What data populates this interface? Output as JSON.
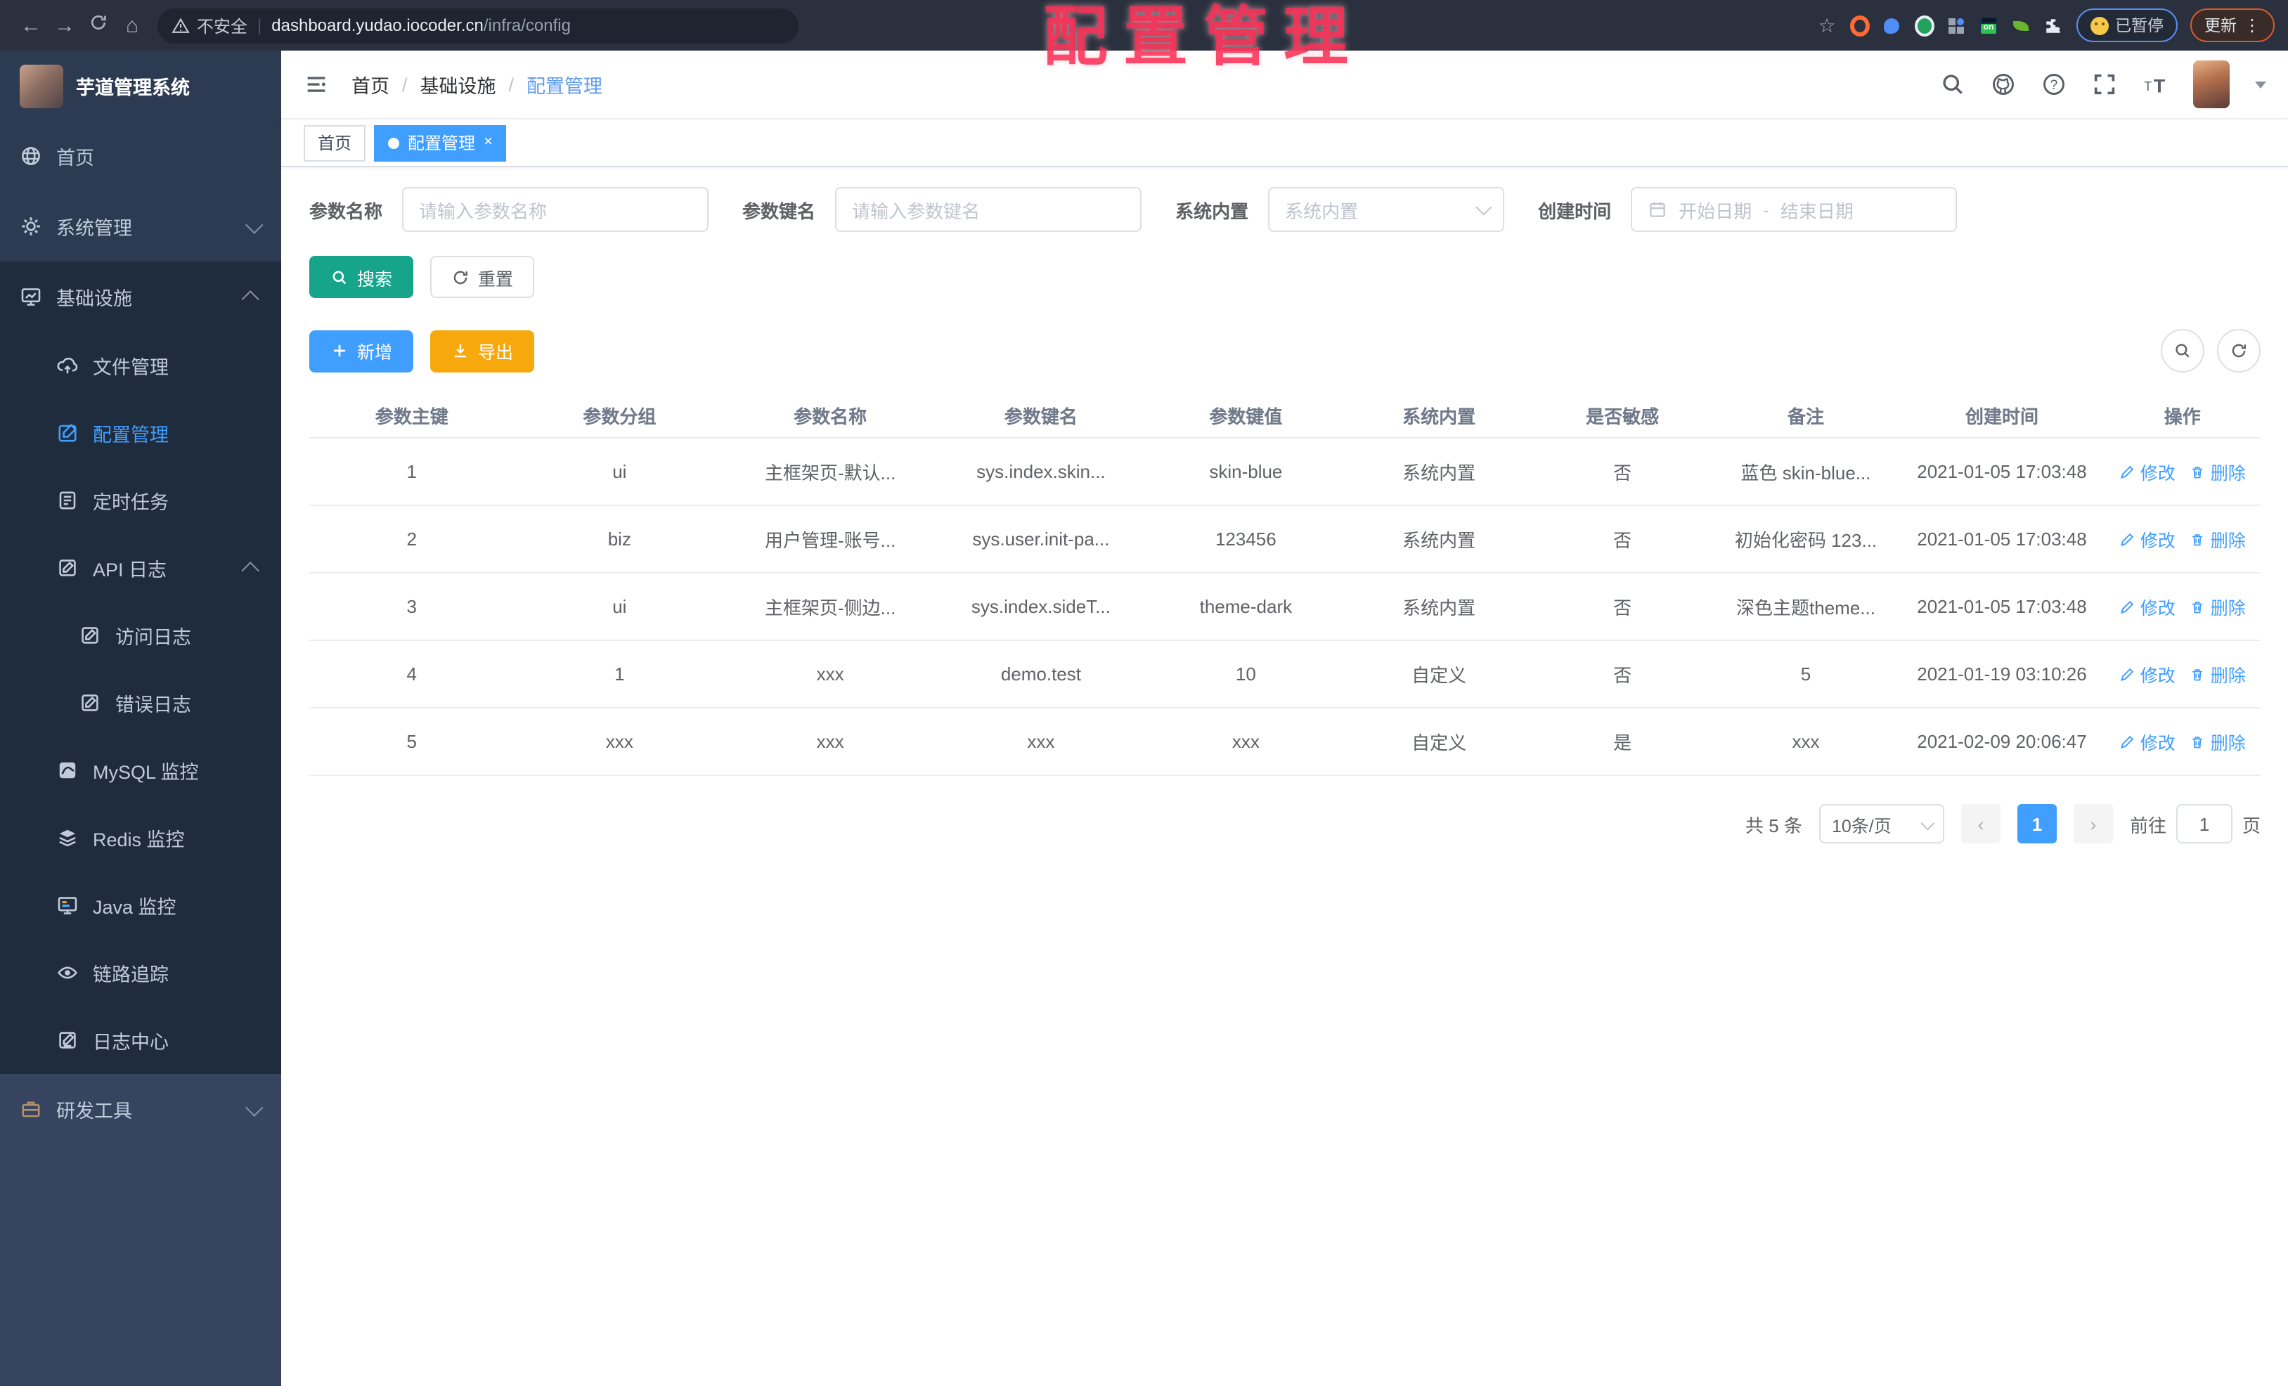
{
  "browser": {
    "back_icon": "←",
    "forward_icon": "→",
    "home_icon": "⌂",
    "star_icon": "☆",
    "security_label": "不安全",
    "url_host": "dashboard.yudao.iocoder.cn",
    "url_path": "/infra/config",
    "paused_label": "已暂停",
    "update_label": "更新",
    "menu_dots": "⋮"
  },
  "overlay": {
    "title": "配置管理"
  },
  "sidebar": {
    "title": "芋道管理系统",
    "items": [
      {
        "label": "首页",
        "icon": "dashboard-icon",
        "level": 1,
        "section": "top"
      },
      {
        "label": "系统管理",
        "icon": "gear-icon",
        "level": 1,
        "section": "top",
        "chevron": "down"
      },
      {
        "label": "基础设施",
        "icon": "infra-icon",
        "level": 1,
        "section": "dark",
        "chevron": "up"
      },
      {
        "label": "文件管理",
        "icon": "cloud-upload-icon",
        "level": 2,
        "section": "dark"
      },
      {
        "label": "配置管理",
        "icon": "edit-square-icon",
        "level": 2,
        "section": "dark",
        "active": true
      },
      {
        "label": "定时任务",
        "icon": "schedule-icon",
        "level": 2,
        "section": "dark"
      },
      {
        "label": "API 日志",
        "icon": "log-icon",
        "level": 2,
        "section": "dark",
        "chevron": "up"
      },
      {
        "label": "访问日志",
        "icon": "log-icon",
        "level": 3,
        "section": "dark"
      },
      {
        "label": "错误日志",
        "icon": "log-icon",
        "level": 3,
        "section": "dark"
      },
      {
        "label": "MySQL 监控",
        "icon": "mysql-icon",
        "level": 2,
        "section": "dark"
      },
      {
        "label": "Redis 监控",
        "icon": "redis-icon",
        "level": 2,
        "section": "dark"
      },
      {
        "label": "Java 监控",
        "icon": "java-icon",
        "level": 2,
        "section": "dark"
      },
      {
        "label": "链路追踪",
        "icon": "trace-eye-icon",
        "level": 2,
        "section": "dark"
      },
      {
        "label": "日志中心",
        "icon": "log-center-icon",
        "level": 2,
        "section": "dark"
      },
      {
        "label": "研发工具",
        "icon": "tools-icon",
        "level": 1,
        "section": "bottom",
        "chevron": "down"
      }
    ]
  },
  "header": {
    "breadcrumb": [
      "首页",
      "基础设施",
      "配置管理"
    ],
    "separator": "/"
  },
  "tabs": [
    {
      "label": "首页",
      "active": false
    },
    {
      "label": "配置管理",
      "active": true,
      "close_icon": "×"
    }
  ],
  "filters": {
    "name": {
      "label": "参数名称",
      "placeholder": "请输入参数名称"
    },
    "key": {
      "label": "参数键名",
      "placeholder": "请输入参数键名"
    },
    "builtin": {
      "label": "系统内置",
      "placeholder": "系统内置"
    },
    "created": {
      "label": "创建时间",
      "start_placeholder": "开始日期",
      "range_separator": "-",
      "end_placeholder": "结束日期"
    }
  },
  "toolbar": {
    "search_label": "搜索",
    "reset_label": "重置",
    "add_label": "新增",
    "export_label": "导出"
  },
  "table": {
    "columns": [
      "参数主键",
      "参数分组",
      "参数名称",
      "参数键名",
      "参数键值",
      "系统内置",
      "是否敏感",
      "备注",
      "创建时间",
      "操作"
    ],
    "rows": [
      [
        "1",
        "ui",
        "主框架页-默认...",
        "sys.index.skin...",
        "skin-blue",
        "系统内置",
        "否",
        "蓝色 skin-blue...",
        "2021-01-05 17:03:48"
      ],
      [
        "2",
        "biz",
        "用户管理-账号...",
        "sys.user.init-pa...",
        "123456",
        "系统内置",
        "否",
        "初始化密码 123...",
        "2021-01-05 17:03:48"
      ],
      [
        "3",
        "ui",
        "主框架页-侧边...",
        "sys.index.sideT...",
        "theme-dark",
        "系统内置",
        "否",
        "深色主题theme...",
        "2021-01-05 17:03:48"
      ],
      [
        "4",
        "1",
        "xxx",
        "demo.test",
        "10",
        "自定义",
        "否",
        "5",
        "2021-01-19 03:10:26"
      ],
      [
        "5",
        "xxx",
        "xxx",
        "xxx",
        "xxx",
        "自定义",
        "是",
        "xxx",
        "2021-02-09 20:06:47"
      ]
    ],
    "actions": {
      "edit_label": "修改",
      "delete_label": "删除"
    }
  },
  "pagination": {
    "total": "共 5 条",
    "page_size": "10条/页",
    "prev_icon": "‹",
    "current_page": "1",
    "next_icon": "›",
    "goto_label": "前往",
    "goto_value": "1",
    "page_unit": "页"
  },
  "colors": {
    "accent": "#409eff",
    "success": "#16a58a",
    "warning": "#f7a80d",
    "sidebar_dark": "#1f2c3d",
    "overlay_pink": "#fa2d54"
  }
}
